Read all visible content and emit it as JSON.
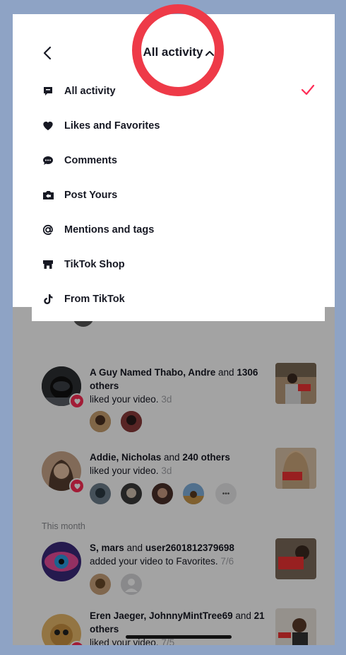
{
  "header": {
    "title": "All activity"
  },
  "menu": {
    "items": [
      {
        "label": "All activity",
        "icon": "message-square-icon",
        "selected": true
      },
      {
        "label": "Likes and Favorites",
        "icon": "heart-icon",
        "selected": false
      },
      {
        "label": "Comments",
        "icon": "comment-bubble-icon",
        "selected": false
      },
      {
        "label": "Post Yours",
        "icon": "post-yours-icon",
        "selected": false
      },
      {
        "label": "Mentions and tags",
        "icon": "at-sign-icon",
        "selected": false
      },
      {
        "label": "TikTok Shop",
        "icon": "shop-icon",
        "selected": false
      },
      {
        "label": "From TikTok",
        "icon": "tiktok-logo-icon",
        "selected": false
      }
    ],
    "check_color": "#fe2c55"
  },
  "feed": {
    "rows": [
      {
        "names": "A Guy Named Thabo, Andre",
        "connector": " and ",
        "others": "1306 others",
        "action": "liked your video.",
        "time": "3d"
      },
      {
        "names": "Addie, Nicholas",
        "connector": " and ",
        "others": "240 others",
        "action": "liked your video.",
        "time": "3d"
      },
      {
        "names": "S, mars",
        "connector": " and ",
        "others": "user2601812379698",
        "action": "added your video to Favorites.",
        "time": "7/6"
      },
      {
        "names": "Eren Jaeger, JohnnyMintTree69",
        "connector": " and ",
        "others": "21 others",
        "action": "liked your video.",
        "time": "7/5"
      }
    ],
    "section_this_month": "This month",
    "more_glyph": "•••"
  },
  "colors": {
    "accent": "#fe2c55",
    "background_frame": "#8ea3c5",
    "annotation_circle": "#ee3a48"
  }
}
